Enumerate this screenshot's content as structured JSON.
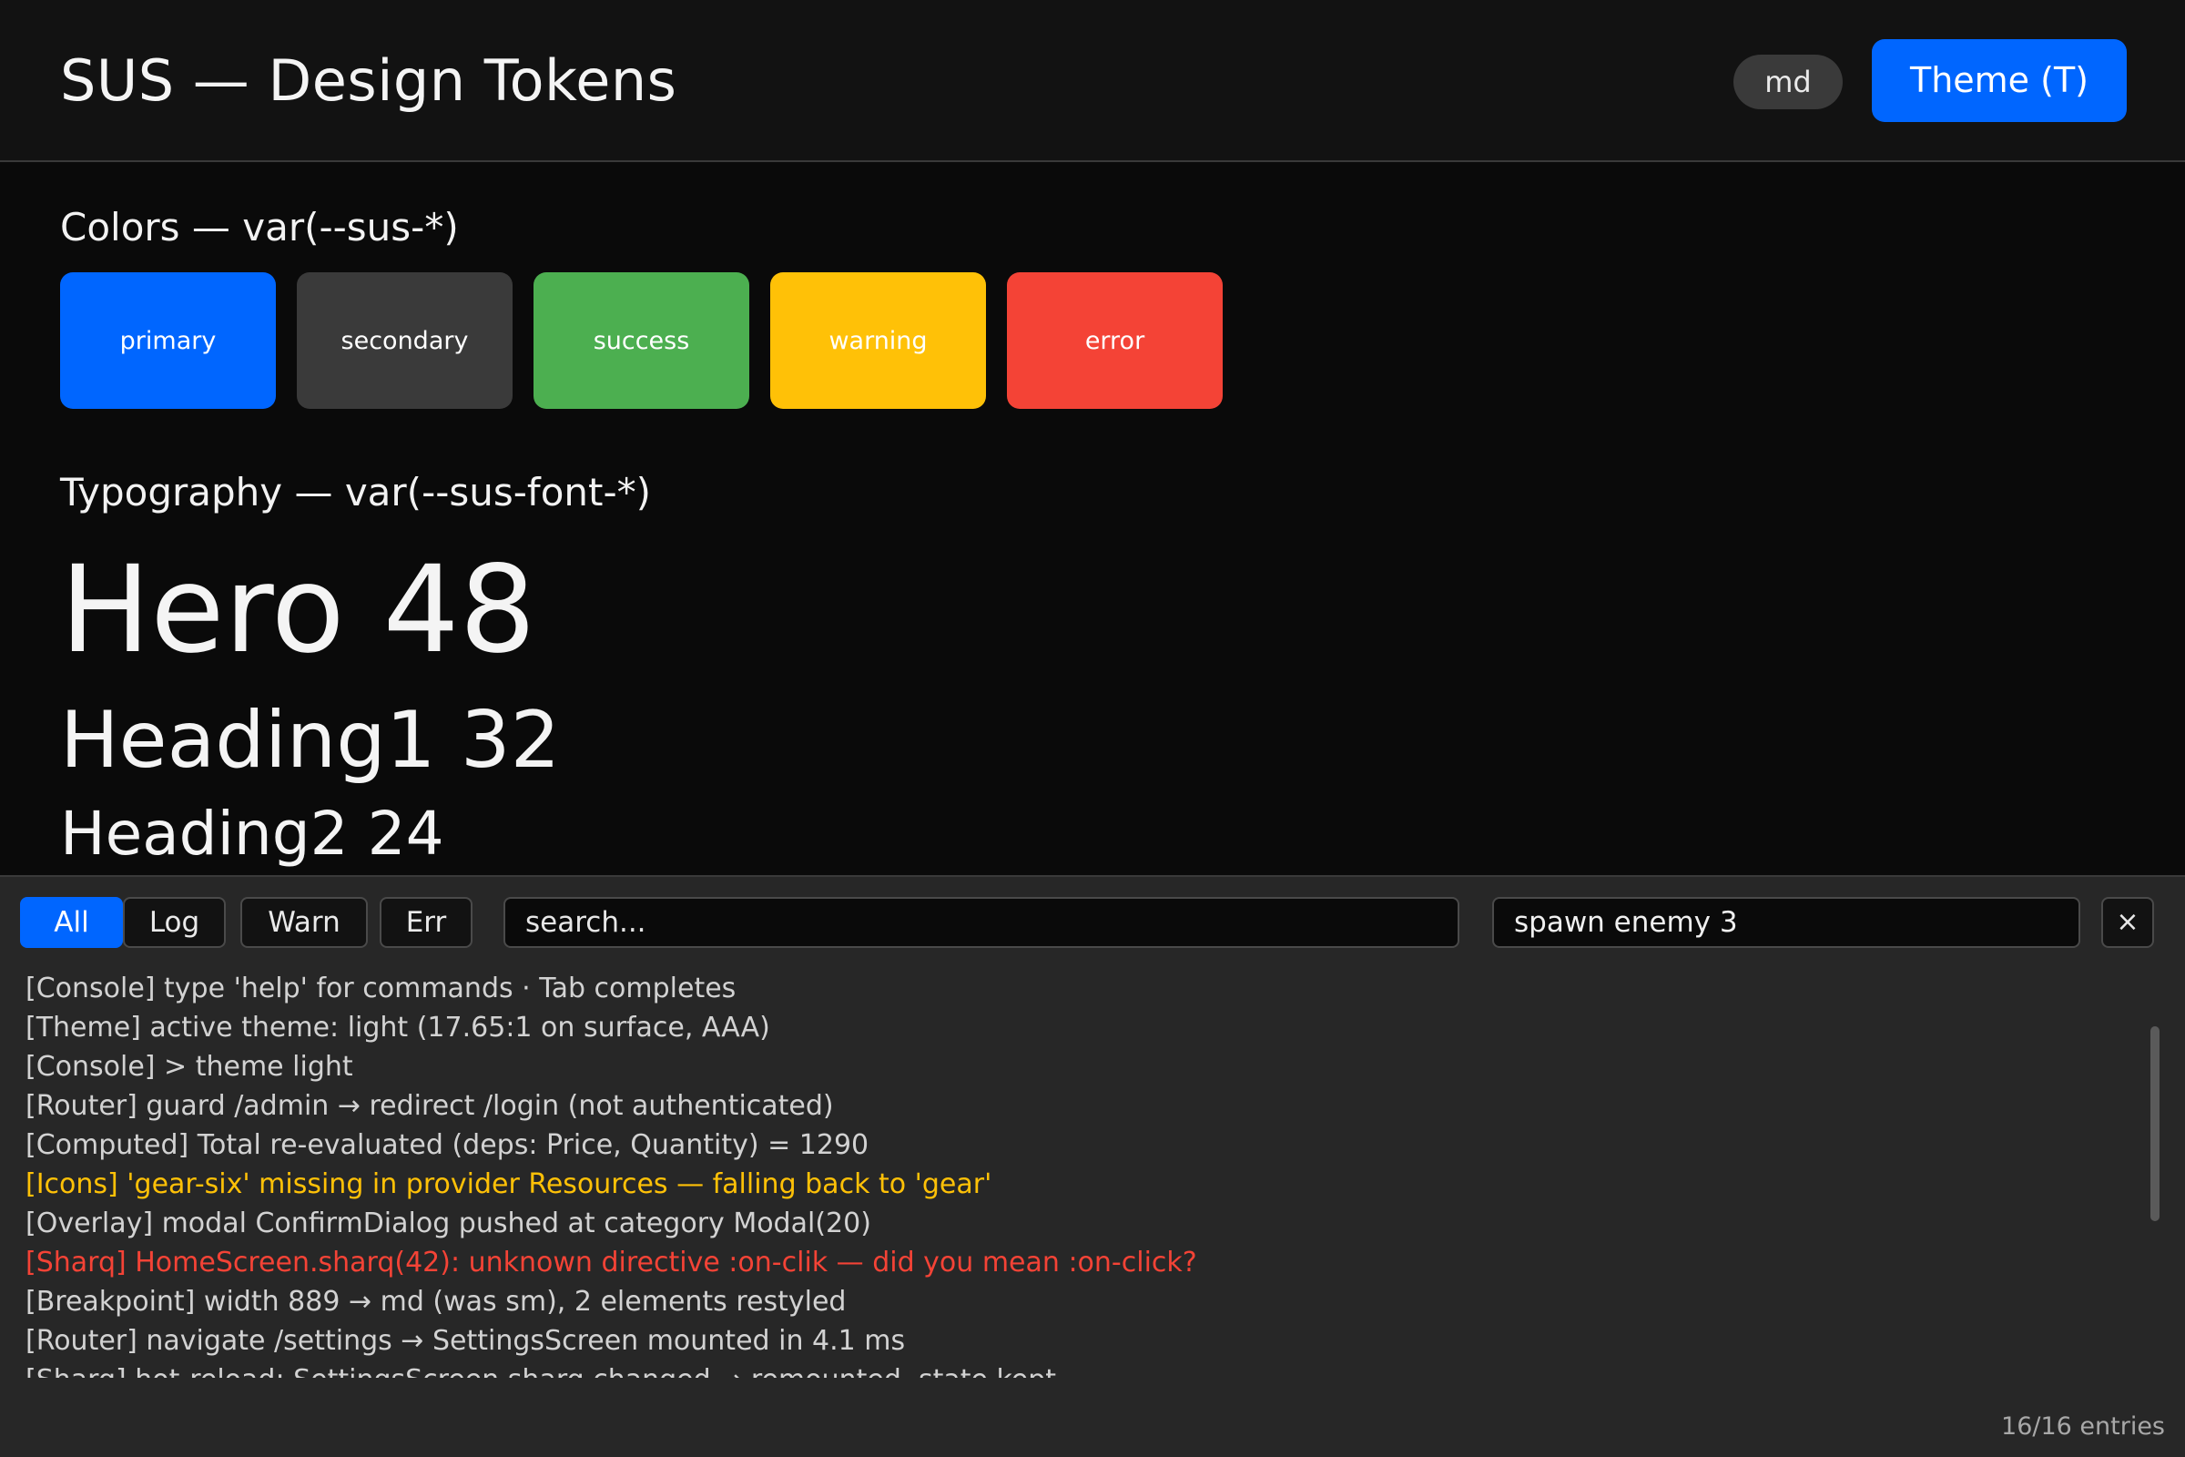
{
  "header": {
    "title": "SUS — Design Tokens",
    "breakpoint": "md",
    "theme_button": "Theme (T)"
  },
  "colors_section": {
    "title": "Colors — var(--sus-*)",
    "swatches": [
      {
        "label": "primary",
        "color": "#0066ff"
      },
      {
        "label": "secondary",
        "color": "#3a3a3a"
      },
      {
        "label": "success",
        "color": "#4caf50"
      },
      {
        "label": "warning",
        "color": "#ffc107"
      },
      {
        "label": "error",
        "color": "#f44336"
      }
    ]
  },
  "typography_section": {
    "title": "Typography — var(--sus-font-*)",
    "hero": "Hero 48",
    "heading1": "Heading1 32",
    "heading2": "Heading2 24"
  },
  "console": {
    "filters": [
      "All",
      "Log",
      "Warn",
      "Err"
    ],
    "active_filter": "All",
    "search_placeholder": "search...",
    "command_value": "spawn enemy 3",
    "close_icon": "×",
    "lines": [
      {
        "text": "[Console] type 'help' for commands · Tab completes",
        "level": "log"
      },
      {
        "text": "[Theme] active theme: light (17.65:1 on surface, AAA)",
        "level": "log"
      },
      {
        "text": "[Console] > theme light",
        "level": "log"
      },
      {
        "text": "[Router] guard /admin → redirect /login (not authenticated)",
        "level": "log"
      },
      {
        "text": "[Computed] Total re-evaluated (deps: Price, Quantity) = 1290",
        "level": "log"
      },
      {
        "text": "[Icons] 'gear-six' missing in provider Resources — falling back to 'gear'",
        "level": "warn"
      },
      {
        "text": "[Overlay] modal ConfirmDialog pushed at category Modal(20)",
        "level": "log"
      },
      {
        "text": "[Sharq] HomeScreen.sharq(42): unknown directive :on-clik — did you mean :on-click?",
        "level": "err"
      },
      {
        "text": "[Breakpoint] width 889 → md (was sm), 2 elements restyled",
        "level": "log"
      },
      {
        "text": "[Router] navigate /settings → SettingsScreen mounted in 4.1 ms",
        "level": "log"
      },
      {
        "text": "[Sharq] hot-reload: SettingsScreen.sharq changed → remounted, state kept",
        "level": "log"
      }
    ],
    "entry_count": "16/16 entries"
  }
}
